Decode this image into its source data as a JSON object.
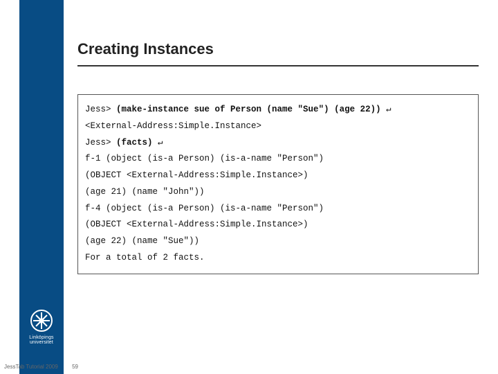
{
  "title": "Creating Instances",
  "code": {
    "l1a": "Jess> ",
    "l1b": "(make-instance sue of Person (name \"Sue\") (age 22))",
    "l1c": " ↵",
    "l2": "<External-Address:Simple.Instance>",
    "l3a": "Jess> ",
    "l3b": "(facts)",
    "l3c": " ↵",
    "l4": "f-1 (object (is-a Person) (is-a-name \"Person\")",
    "l5": "(OBJECT <External-Address:Simple.Instance>)",
    "l6": "(age 21) (name \"John\"))",
    "l7": "f-4 (object (is-a Person) (is-a-name \"Person\")",
    "l8": "(OBJECT <External-Address:Simple.Instance>)",
    "l9": "(age 22) (name \"Sue\"))",
    "l10": "For a total of 2 facts."
  },
  "logo_text": "Linköpings universitet",
  "footer_text": "JessTab Tutorial 2009",
  "page_number": "59"
}
